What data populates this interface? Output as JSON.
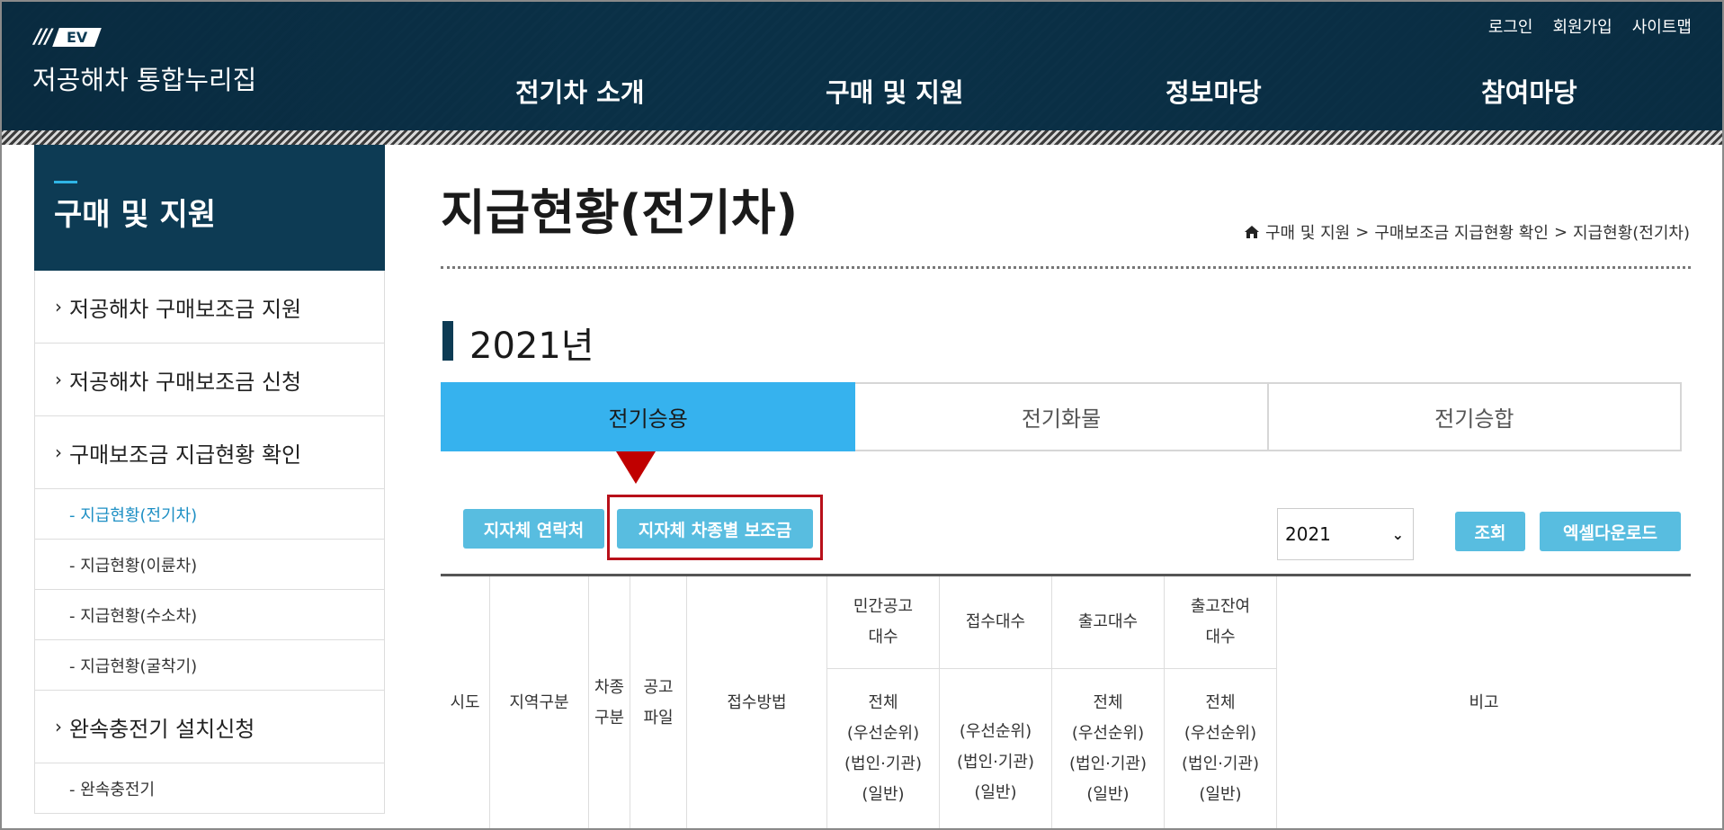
{
  "header": {
    "logo_slashes": "///",
    "logo_badge": "EV",
    "site_name": "저공해차 통합누리집",
    "util": [
      "로그인",
      "회원가입",
      "사이트맵"
    ],
    "nav": [
      "전기차 소개",
      "구매 및 지원",
      "정보마당",
      "참여마당"
    ]
  },
  "sidebar": {
    "title": "구매 및 지원",
    "items": [
      {
        "label": "저공해차 구매보조금 지원",
        "level": "main"
      },
      {
        "label": "저공해차 구매보조금 신청",
        "level": "main"
      },
      {
        "label": "구매보조금 지급현황 확인",
        "level": "main"
      },
      {
        "label": "- 지급현황(전기차)",
        "level": "sub",
        "active": true
      },
      {
        "label": "- 지급현황(이륜차)",
        "level": "sub"
      },
      {
        "label": "- 지급현황(수소차)",
        "level": "sub"
      },
      {
        "label": "- 지급현황(굴착기)",
        "level": "sub"
      },
      {
        "label": "완속충전기 설치신청",
        "level": "main"
      },
      {
        "label": "- 완속충전기",
        "level": "sub"
      }
    ]
  },
  "main": {
    "title": "지급현황(전기차)",
    "breadcrumb": [
      "구매 및 지원",
      "구매보조금 지급현황 확인",
      "지급현황(전기차)"
    ],
    "year_heading": "2021년",
    "tabs": [
      {
        "label": "전기승용",
        "active": true
      },
      {
        "label": "전기화물",
        "active": false
      },
      {
        "label": "전기승합",
        "active": false
      }
    ],
    "buttons": {
      "contact": "지자체 연락처",
      "subsidy": "지자체 차종별 보조금",
      "search": "조회",
      "excel": "엑셀다운로드"
    },
    "year_select": "2021",
    "table": {
      "headers": {
        "sido": "시도",
        "region": "지역구분",
        "car_type": "차종\n구분",
        "notice_file": "공고\n파일",
        "method": "접수방법",
        "public_notice": "민간공고\n대수",
        "received": "접수대수",
        "released": "출고대수",
        "remaining": "출고잔여\n대수",
        "note": "비고"
      },
      "subheaders": {
        "public_notice": "전체\n(우선순위)\n(법인·기관)\n(일반)",
        "received": "(우선순위)\n(법인·기관)\n(일반)",
        "released": "전체\n(우선순위)\n(법인·기관)\n(일반)",
        "remaining": "전체\n(우선순위)\n(법인·기관)\n(일반)"
      }
    }
  },
  "colors": {
    "header_bg": "#0d3b54",
    "tab_active": "#36b2ee",
    "button": "#58bde0",
    "highlight": "#b8101a",
    "sidebar_active": "#1d8fc4"
  }
}
